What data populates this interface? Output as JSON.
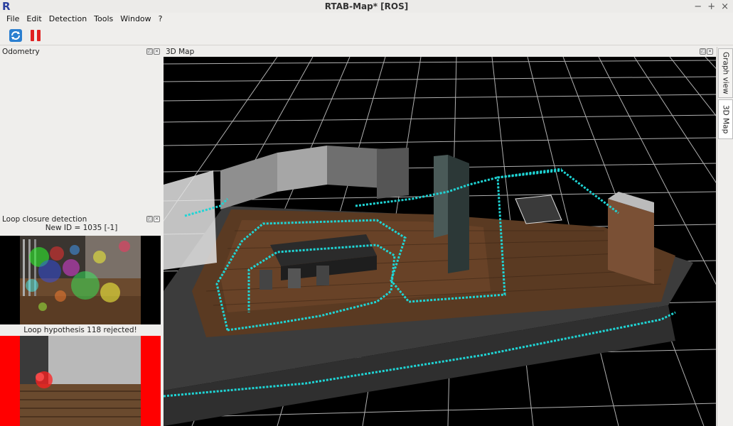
{
  "window": {
    "logo": "R",
    "title": "RTAB-Map* [ROS]",
    "controls": {
      "minimize": "−",
      "maximize": "+",
      "close": "×"
    }
  },
  "menu": [
    "File",
    "Edit",
    "Detection",
    "Tools",
    "Window",
    "?"
  ],
  "toolbar": {
    "buttons": [
      {
        "icon": "refresh-icon"
      },
      {
        "icon": "pause-icon"
      }
    ]
  },
  "odometry": {
    "title": "Odometry"
  },
  "loop_closure": {
    "title": "Loop closure detection",
    "new_id": "New ID = 1035 [-1]",
    "hypothesis": "Loop hypothesis 118 rejected!"
  },
  "map": {
    "title": "3D Map"
  },
  "side_tabs": [
    "Graph view",
    "3D Map"
  ],
  "colors": {
    "trajectory": "#1fd5d5",
    "rejected_bg": "#ff0000",
    "map_bg": "#000000",
    "floor": "#5a3a22"
  }
}
